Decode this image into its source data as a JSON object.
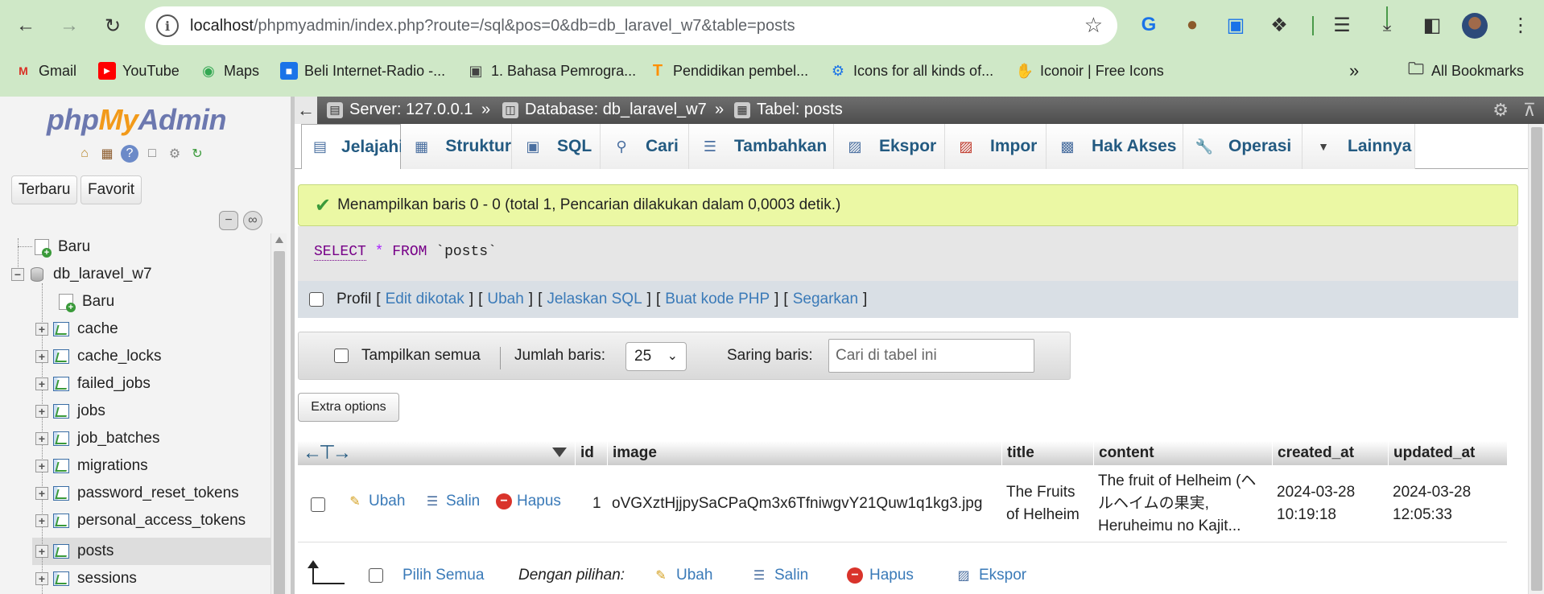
{
  "browser": {
    "url_host": "localhost",
    "url_path": "/phpmyadmin/index.php?route=/sql&pos=0&db=db_laravel_w7&table=posts",
    "bookmarks": [
      {
        "label": "Gmail",
        "icon": "gmail-icon",
        "color": "#d93025"
      },
      {
        "label": "YouTube",
        "icon": "youtube-icon",
        "color": "#ff0000"
      },
      {
        "label": "Maps",
        "icon": "maps-icon",
        "color": "#34a853"
      },
      {
        "label": "Beli Internet-Radio -...",
        "icon": "radio-icon",
        "color": "#1a73e8"
      },
      {
        "label": "1. Bahasa Pemrogra...",
        "icon": "book-icon",
        "color": "#444444"
      },
      {
        "label": "Pendidikan pembel...",
        "icon": "tensorflow-icon",
        "color": "#ff8f00"
      },
      {
        "label": "Icons for all kinds of...",
        "icon": "robot-icon",
        "color": "#1a73e8"
      },
      {
        "label": "Iconoir | Free Icons",
        "icon": "hand-icon",
        "color": "#e0c060"
      }
    ],
    "all_bookmarks": "All Bookmarks"
  },
  "sidebar": {
    "logo": {
      "php": "php",
      "my": "My",
      "admin": "Admin"
    },
    "tab_recent": "Terbaru",
    "tab_favorite": "Favorit",
    "tree": {
      "new_root": "Baru",
      "database": "db_laravel_w7",
      "new_table": "Baru",
      "tables": [
        "cache",
        "cache_locks",
        "failed_jobs",
        "jobs",
        "job_batches",
        "migrations",
        "password_reset_tokens",
        "personal_access_tokens",
        "posts",
        "sessions"
      ],
      "selected": "posts"
    }
  },
  "breadcrumb": {
    "server": "Server: 127.0.0.1",
    "database": "Database: db_laravel_w7",
    "table": "Tabel: posts",
    "sep": "»"
  },
  "tabs": [
    {
      "label": "Jelajahi",
      "icon": "browse-icon",
      "active": true
    },
    {
      "label": "Struktur",
      "icon": "structure-icon"
    },
    {
      "label": "SQL",
      "icon": "sql-icon"
    },
    {
      "label": "Cari",
      "icon": "search-icon"
    },
    {
      "label": "Tambahkan",
      "icon": "insert-icon"
    },
    {
      "label": "Ekspor",
      "icon": "export-icon"
    },
    {
      "label": "Impor",
      "icon": "import-icon"
    },
    {
      "label": "Hak Akses",
      "icon": "privileges-icon"
    },
    {
      "label": "Operasi",
      "icon": "wrench-icon"
    },
    {
      "label": "Lainnya",
      "icon": "chevron-down-icon"
    }
  ],
  "message": "Menampilkan baris 0 - 0 (total 1, Pencarian dilakukan dalam 0,0003 detik.)",
  "sql": {
    "select": "SELECT",
    "star": "*",
    "from": "FROM",
    "table": "`posts`"
  },
  "profile": {
    "label": "Profil",
    "links": [
      "Edit dikotak",
      "Ubah",
      "Jelaskan SQL",
      "Buat kode PHP",
      "Segarkan"
    ]
  },
  "filter": {
    "show_all": "Tampilkan semua",
    "rows_label": "Jumlah baris:",
    "rows_value": "25",
    "filter_label": "Saring baris:",
    "filter_placeholder": "Cari di tabel ini"
  },
  "extra_options": "Extra options",
  "table": {
    "columns": [
      "id",
      "image",
      "title",
      "content",
      "created_at",
      "updated_at"
    ],
    "row_actions": {
      "edit": "Ubah",
      "copy": "Salin",
      "delete": "Hapus"
    },
    "rows": [
      {
        "id": "1",
        "image": "oVGXztHjjpySaCPaQm3x6TfniwgvY21Quw1q1kg3.jpg",
        "title_line1": "The Fruits",
        "title_line2": "of Helheim",
        "content_line1": "The fruit of Helheim (ヘ",
        "content_line2": "ルヘイムの果実,",
        "content_line3": "Heruheimu no Kajit...",
        "created_date": "2024-03-28",
        "created_time": "10:19:18",
        "updated_date": "2024-03-28",
        "updated_time": "12:05:33"
      }
    ]
  },
  "bulk": {
    "select_all": "Pilih Semua",
    "with_selected": "Dengan pilihan:",
    "edit": "Ubah",
    "copy": "Salin",
    "delete": "Hapus",
    "export": "Ekspor"
  }
}
